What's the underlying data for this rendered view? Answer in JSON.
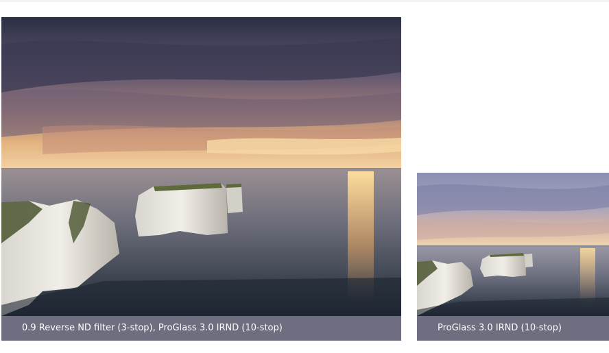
{
  "photos": [
    {
      "subject": "sea-stacks-long-exposure-photo",
      "caption": "0.9 Reverse ND filter (3-stop), ProGlass 3.0 IRND (10-stop)"
    },
    {
      "subject": "sea-stacks-long-exposure-photo",
      "caption": "ProGlass 3.0 IRND (10-stop)"
    }
  ],
  "colors": {
    "caption_bar": "#6e6e80",
    "caption_text": "#ffffff"
  }
}
